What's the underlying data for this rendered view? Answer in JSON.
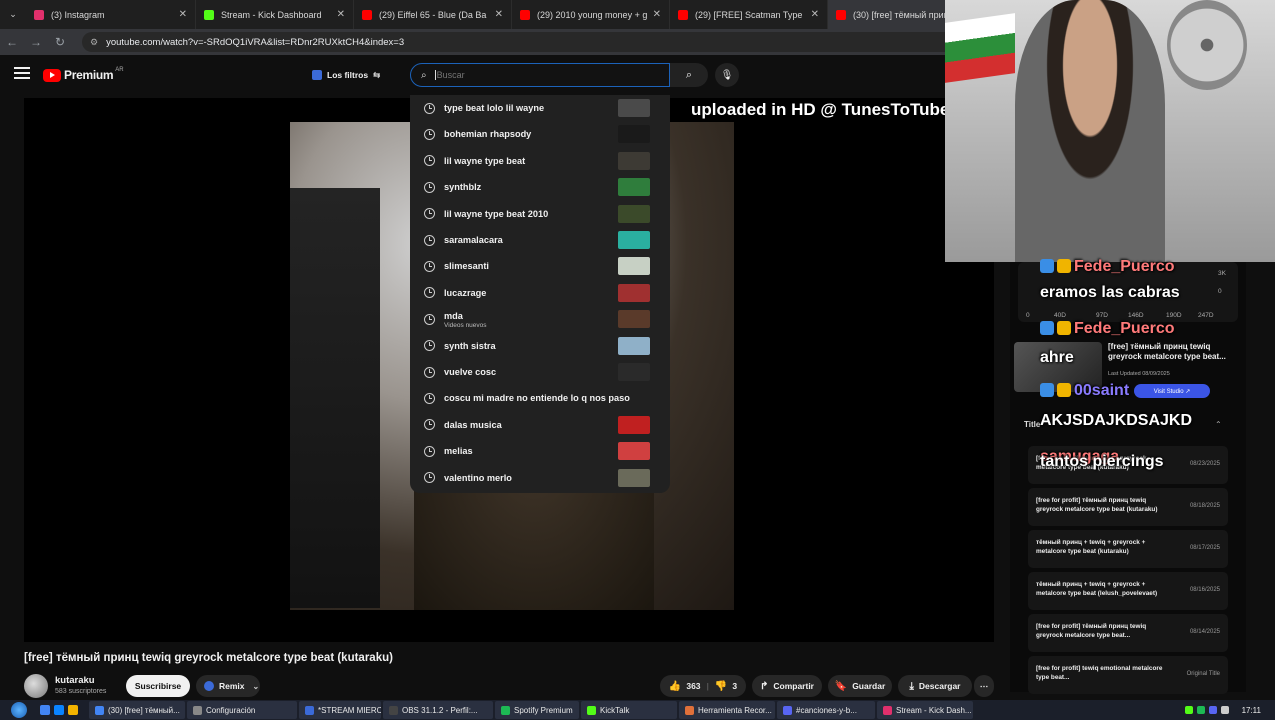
{
  "browser": {
    "tabs": [
      {
        "label": "(3) Instagram",
        "color": "#e1306c",
        "active": false
      },
      {
        "label": "Stream - Kick Dashboard",
        "color": "#53fc18",
        "active": false
      },
      {
        "label": "(29) Eiffel 65 - Blue (Da Ba Dee",
        "color": "#ff0000",
        "active": false
      },
      {
        "label": "(29) 2010 young money + glo",
        "color": "#ff0000",
        "active": false
      },
      {
        "label": "(29) [FREE] Scatman Type Beat",
        "color": "#ff0000",
        "active": false
      },
      {
        "label": "(30) [free] тёмный принц tew",
        "color": "#ff0000",
        "active": true
      }
    ],
    "url": "youtube.com/watch?v=-SRdOQ1iVRA&list=RDnr2RUXktCH4&index=3"
  },
  "youtube": {
    "logo_text": "Premium",
    "country": "AR",
    "filters_label": "Los filtros",
    "search_placeholder": "Buscar",
    "suggestions": [
      {
        "label": "type beat lolo lil wayne",
        "thumb": "#4a4a4a"
      },
      {
        "label": "bohemian rhapsody",
        "thumb": "#1a1a1a"
      },
      {
        "label": "lil wayne type beat",
        "thumb": "#3d3a34"
      },
      {
        "label": "synthblz",
        "thumb": "#2f7d3c"
      },
      {
        "label": "lil wayne type beat 2010",
        "thumb": "#3b4a2a"
      },
      {
        "label": "saramalacara",
        "thumb": "#2ab0a0"
      },
      {
        "label": "slimesanti",
        "thumb": "#c7d0c4"
      },
      {
        "label": "lucazrage",
        "thumb": "#a03030"
      },
      {
        "label": "mda",
        "sub": "Videos nuevos",
        "thumb": "#5a3a2a"
      },
      {
        "label": "synth sistra",
        "thumb": "#8fb0c8"
      },
      {
        "label": "vuelve cosc",
        "thumb": "#2a2a2a"
      },
      {
        "label": "coscu mi madre no entiende lo q nos paso",
        "thumb": ""
      },
      {
        "label": "dalas musica",
        "thumb": "#c02020"
      },
      {
        "label": "melias",
        "thumb": "#d04040"
      },
      {
        "label": "valentino merlo",
        "thumb": "#6a6a5a"
      }
    ],
    "video_overlay_text": "uploaded in HD @ TunesToTube",
    "video_title": "[free] тёмный принц tewiq greyrock metalcore type beat (kutaraku)",
    "channel": {
      "name": "kutaraku",
      "subs": "583 suscriptores"
    },
    "subscribe_label": "Suscribirse",
    "remix_label": "Remix",
    "likes": "363",
    "dislikes": "3",
    "share_label": "Compartir",
    "save_label": "Guardar",
    "download_label": "Descargar"
  },
  "panel": {
    "stats": [
      "3K",
      "0",
      "0",
      "40D",
      "97D",
      "146D",
      "190D",
      "247D"
    ],
    "card_title": "[free] тёмный принц tewiq greyrock metalcore type beat...",
    "card_updated": "Last Updated 08/09/2025",
    "card_button": "Visit Studio ↗",
    "titles_header": "Title",
    "titles": [
      {
        "t": "[free] тёмный принц tewiq greyrock metalcore type beat (kutaraku)",
        "d": "08/23/2025"
      },
      {
        "t": "[free for profit] тёмный принц tewiq greyrock metalcore type beat (kutaraku)",
        "d": "08/18/2025"
      },
      {
        "t": "тёмный принц + tewiq + greyrock + metalcore type beat (kutaraku)",
        "d": "08/17/2025"
      },
      {
        "t": "тёмный принц + tewiq + greyrock + metalcore type beat (lelush_povelevaet)",
        "d": "08/16/2025"
      },
      {
        "t": "[free for profit] тёмный принц tewiq greyrock metalcore type beat...",
        "d": "08/14/2025"
      },
      {
        "t": "[free for profit] tewiq emotional metalcore type beat...",
        "d": "Original Title"
      }
    ]
  },
  "chat": [
    {
      "user": "Fede_Puerco",
      "msg": "eramos las cabras"
    },
    {
      "user": "Fede_Puerco",
      "msg": "ahre"
    },
    {
      "user": "00saint",
      "msg": "AKJSDAJKDSAJKD"
    },
    {
      "user": "samugaga",
      "msg": "tantos piercings"
    }
  ],
  "taskbar": {
    "items": [
      {
        "label": "(30) [free] тёмный...",
        "color": "#4285f4"
      },
      {
        "label": "Configuración",
        "color": "#888888"
      },
      {
        "label": "*STREAM MIERCO...",
        "color": "#3b6ad8"
      },
      {
        "label": "OBS 31.1.2 - Perfil:...",
        "color": "#444444"
      },
      {
        "label": "Spotify Premium",
        "color": "#1db954"
      },
      {
        "label": "KickTalk",
        "color": "#53fc18"
      },
      {
        "label": "Herramienta Recor...",
        "color": "#e0703a"
      },
      {
        "label": "#canciones-y-b...",
        "color": "#5865f2"
      },
      {
        "label": "Stream - Kick Dash...",
        "color": "#e1306c"
      }
    ],
    "clock": "17:11"
  }
}
